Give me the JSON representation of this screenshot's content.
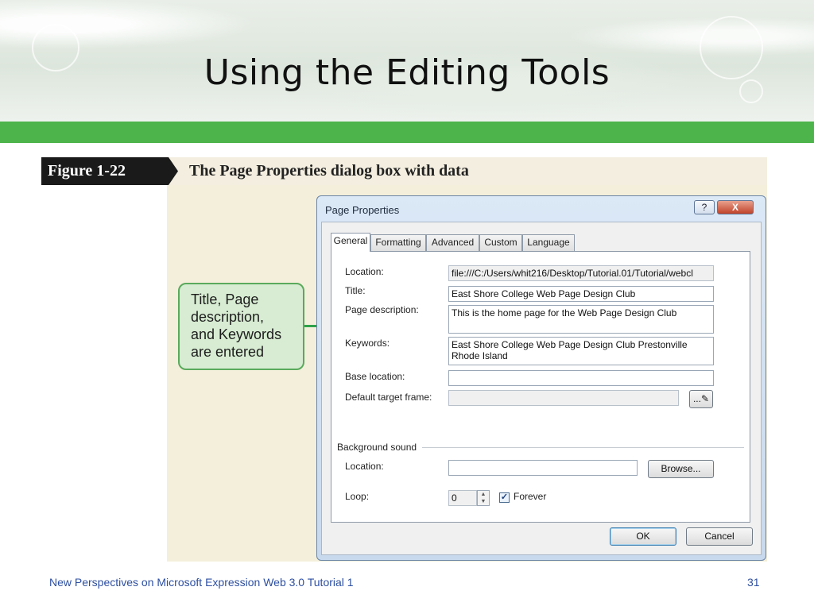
{
  "slide": {
    "title": "Using the Editing Tools",
    "footer_left": "New Perspectives on Microsoft Expression Web 3.0 Tutorial 1",
    "page_number": "31",
    "accent_color": "#4cb44a"
  },
  "figure": {
    "label": "Figure 1-22",
    "caption": "The Page Properties dialog box with data"
  },
  "callout": {
    "lines": [
      "Title, Page",
      "description,",
      "and Keywords",
      "are entered"
    ]
  },
  "dialog": {
    "title": "Page Properties",
    "help_label": "?",
    "close_label": "X",
    "tabs": [
      {
        "label": "General",
        "active": true
      },
      {
        "label": "Formatting",
        "active": false
      },
      {
        "label": "Advanced",
        "active": false
      },
      {
        "label": "Custom",
        "active": false
      },
      {
        "label": "Language",
        "active": false
      }
    ],
    "general": {
      "location_label": "Location:",
      "location_value": "file:///C:/Users/whit216/Desktop/Tutorial.01/Tutorial/webcl",
      "title_label": "Title:",
      "title_value": "East Shore College Web Page Design Club",
      "description_label": "Page description:",
      "description_value": "This is the home page for the Web Page Design Club",
      "keywords_label": "Keywords:",
      "keywords_value": "East Shore College Web Page Design Club Prestonville Rhode Island",
      "base_location_label": "Base location:",
      "base_location_value": "",
      "target_frame_label": "Default target frame:",
      "target_frame_value": "",
      "target_frame_button": "..."
    },
    "background_sound": {
      "group_label": "Background sound",
      "location_label": "Location:",
      "location_value": "",
      "browse_button": "Browse...",
      "loop_label": "Loop:",
      "loop_value": "0",
      "forever_label": "Forever",
      "forever_checked": true
    },
    "ok_button": "OK",
    "cancel_button": "Cancel"
  }
}
